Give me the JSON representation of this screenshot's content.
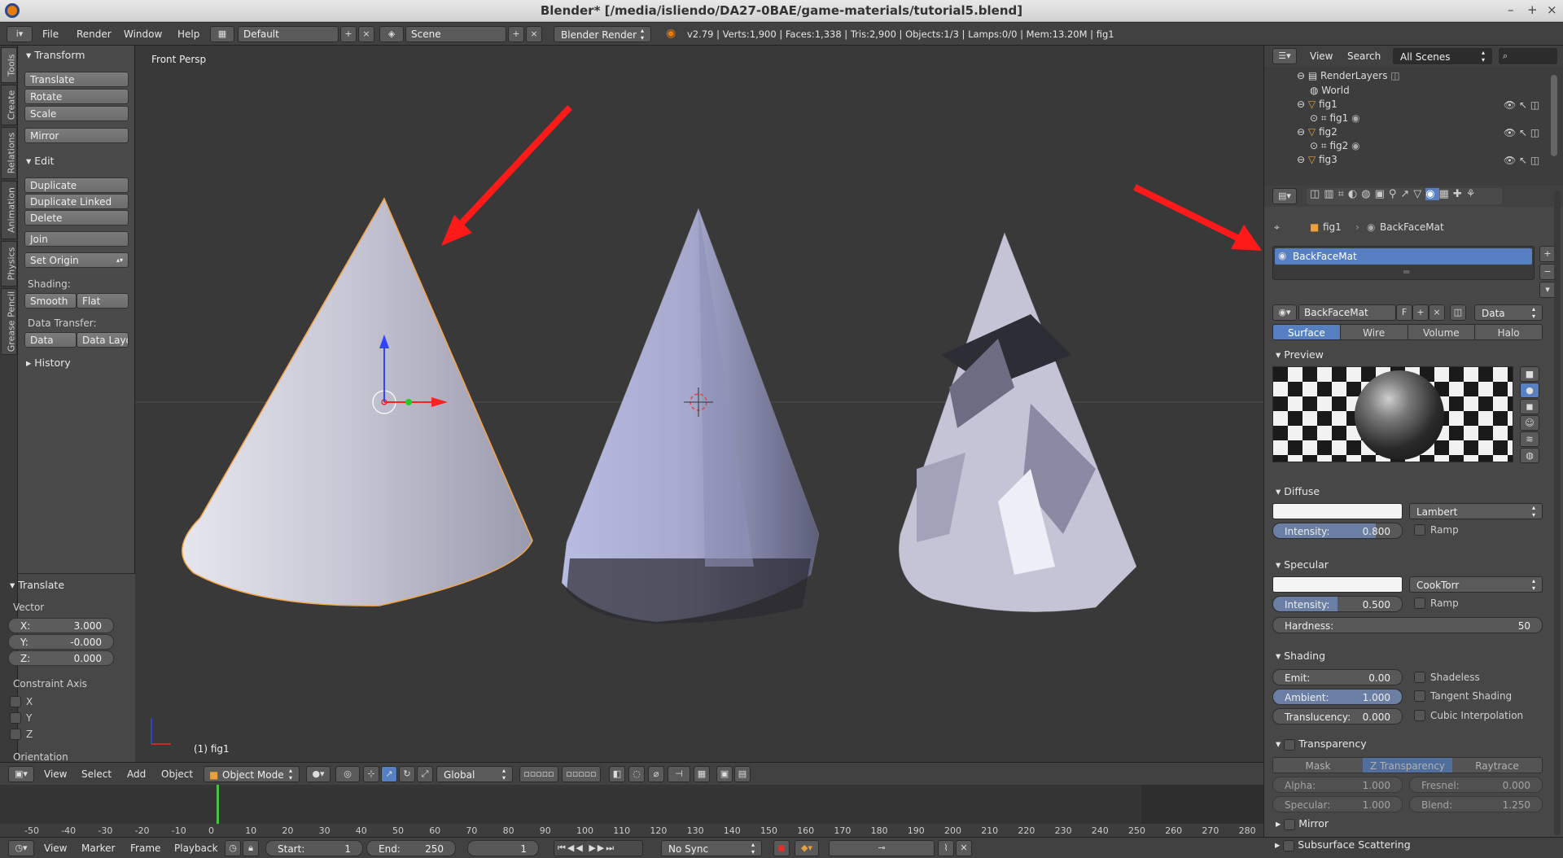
{
  "window": {
    "title": "Blender* [/media/isliendo/DA27-0BAE/game-materials/tutorial5.blend]",
    "controls": [
      "–",
      "+",
      "×"
    ]
  },
  "info": {
    "menus": [
      "File",
      "Render",
      "Window",
      "Help"
    ],
    "layout": "Default",
    "scene": "Scene",
    "engine": "Blender Render",
    "stats": "v2.79 | Verts:1,900 | Faces:1,338 | Tris:2,900 | Objects:1/3 | Lamps:0/0 | Mem:13.20M | fig1"
  },
  "left_tabs": [
    "Tools",
    "Create",
    "Relations",
    "Animation",
    "Physics",
    "Grease Pencil"
  ],
  "toolshelf": {
    "transform_header": "Transform",
    "transform_buttons": [
      "Translate",
      "Rotate",
      "Scale"
    ],
    "mirror": "Mirror",
    "edit_header": "Edit",
    "edit_buttons": [
      "Duplicate",
      "Duplicate Linked",
      "Delete"
    ],
    "join": "Join",
    "set_origin": "Set Origin",
    "shading_label": "Shading:",
    "smooth": "Smooth",
    "flat": "Flat",
    "data_transfer_label": "Data Transfer:",
    "data": "Data",
    "data_layout": "Data Layo",
    "history": "History"
  },
  "operator": {
    "header": "Translate",
    "vector_label": "Vector",
    "x": {
      "k": "X:",
      "v": "3.000"
    },
    "y": {
      "k": "Y:",
      "v": "-0.000"
    },
    "z": {
      "k": "Z:",
      "v": "0.000"
    },
    "constraint_label": "Constraint Axis",
    "axes": [
      "X",
      "Y",
      "Z"
    ],
    "orientation": "Orientation"
  },
  "viewport": {
    "view_label": "Front Persp",
    "object_label": "(1) fig1"
  },
  "vp_header": {
    "menus": [
      "View",
      "Select",
      "Add",
      "Object"
    ],
    "mode": "Object Mode",
    "orientation": "Global"
  },
  "timeline": {
    "ticks": [
      "-50",
      "-40",
      "-30",
      "-20",
      "-10",
      "0",
      "10",
      "20",
      "30",
      "40",
      "50",
      "60",
      "70",
      "80",
      "90",
      "100",
      "110",
      "120",
      "130",
      "140",
      "150",
      "160",
      "170",
      "180",
      "190",
      "200",
      "210",
      "220",
      "230",
      "240",
      "250",
      "260",
      "270",
      "280"
    ]
  },
  "tl_bar": {
    "menus": [
      "View",
      "Marker",
      "Frame",
      "Playback"
    ],
    "start": {
      "k": "Start:",
      "v": "1"
    },
    "end": {
      "k": "End:",
      "v": "250"
    },
    "current": "1",
    "sync": "No Sync"
  },
  "outliner": {
    "menus": [
      "View",
      "Search"
    ],
    "filter": "All Scenes",
    "rows": [
      "RenderLayers",
      "World",
      "fig1",
      "fig1",
      "fig2",
      "fig2",
      "fig3"
    ]
  },
  "props": {
    "breadcrumb": [
      "fig1",
      "BackFaceMat"
    ],
    "slot": "BackFaceMat",
    "material_name": "BackFaceMat",
    "fake_user": "F",
    "link": "Data",
    "tabs": [
      "Surface",
      "Wire",
      "Volume",
      "Halo"
    ],
    "preview_header": "Preview",
    "diffuse_header": "Diffuse",
    "diffuse_shader": "Lambert",
    "diffuse_intensity": {
      "k": "Intensity:",
      "v": "0.800"
    },
    "ramp": "Ramp",
    "specular_header": "Specular",
    "specular_shader": "CookTorr",
    "specular_intensity": {
      "k": "Intensity:",
      "v": "0.500"
    },
    "hardness": {
      "k": "Hardness:",
      "v": "50"
    },
    "shading_header": "Shading",
    "emit": {
      "k": "Emit:",
      "v": "0.00"
    },
    "ambient": {
      "k": "Ambient:",
      "v": "1.000"
    },
    "translucency": {
      "k": "Translucency:",
      "v": "0.000"
    },
    "shadeless": "Shadeless",
    "tangent": "Tangent Shading",
    "cubic": "Cubic Interpolation",
    "transparency_header": "Transparency",
    "trans_tabs": [
      "Mask",
      "Z Transparency",
      "Raytrace"
    ],
    "alpha": {
      "k": "Alpha:",
      "v": "1.000"
    },
    "fresnel": {
      "k": "Fresnel:",
      "v": "0.000"
    },
    "specular_t": {
      "k": "Specular:",
      "v": "1.000"
    },
    "blend": {
      "k": "Blend:",
      "v": "1.250"
    },
    "mirror_header": "Mirror",
    "sss_header": "Subsurface Scattering"
  },
  "colors": {
    "accent": "#5680c2",
    "arrow": "#ff1a1a",
    "selection_outline": "#f5a54a"
  }
}
